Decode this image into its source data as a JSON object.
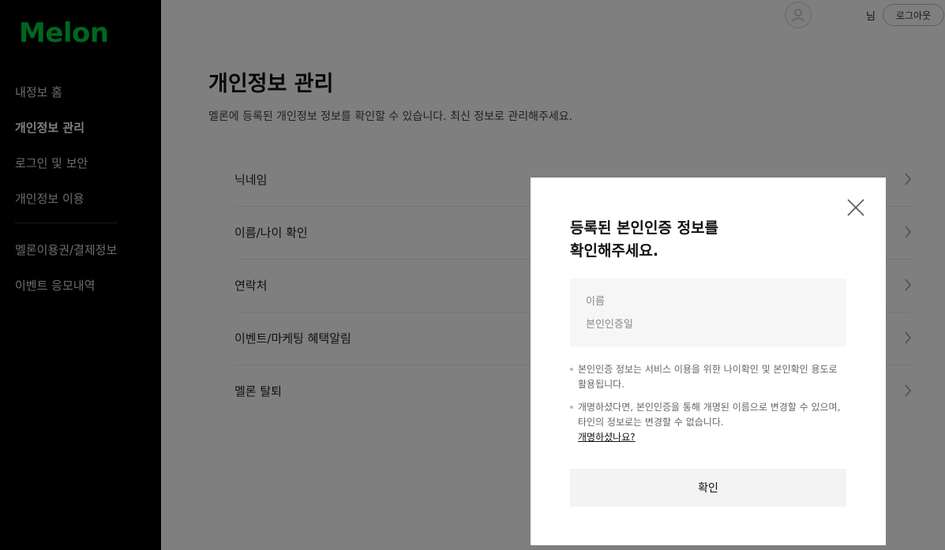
{
  "brand": {
    "logo_text": "Melon",
    "color": "#00cd3c"
  },
  "sidebar": {
    "items": [
      {
        "label": "내정보 홈"
      },
      {
        "label": "개인정보 관리"
      },
      {
        "label": "로그인 및 보안"
      },
      {
        "label": "개인정보 이용"
      },
      {
        "label": "멜론이용권/결제정보"
      },
      {
        "label": "이벤트 응모내역"
      }
    ],
    "active_index": 1
  },
  "topbar": {
    "avatar_icon": "user-avatar-icon",
    "user_suffix": "님",
    "logout_label": "로그아웃"
  },
  "page": {
    "title": "개인정보 관리",
    "description": "멜론에 등록된 개인정보 정보를 확인할 수 있습니다. 최신 정보로 관리해주세요."
  },
  "menu": {
    "rows": [
      {
        "label": "닉네임"
      },
      {
        "label": "이름/나이 확인"
      },
      {
        "label": "연락처"
      },
      {
        "label": "이벤트/마케팅 혜택알림"
      },
      {
        "label": "멜론 탈퇴"
      }
    ]
  },
  "modal": {
    "title_line1": "등록된 본인인증 정보를",
    "title_line2": "확인해주세요.",
    "name_label": "이름",
    "date_label": "본인인증일",
    "note1": "본인인증 정보는 서비스 이용을 위한 나이확인 및 본인확인 용도로 활용됩니다.",
    "note2": "개명하셨다면, 본인인증을 통해 개명된 이름으로 변경할 수 있으며, 타인의 정보로는 변경할 수 없습니다.",
    "note2_link": "개명하셨나요?",
    "confirm_label": "확인",
    "close_icon": "close-icon"
  }
}
